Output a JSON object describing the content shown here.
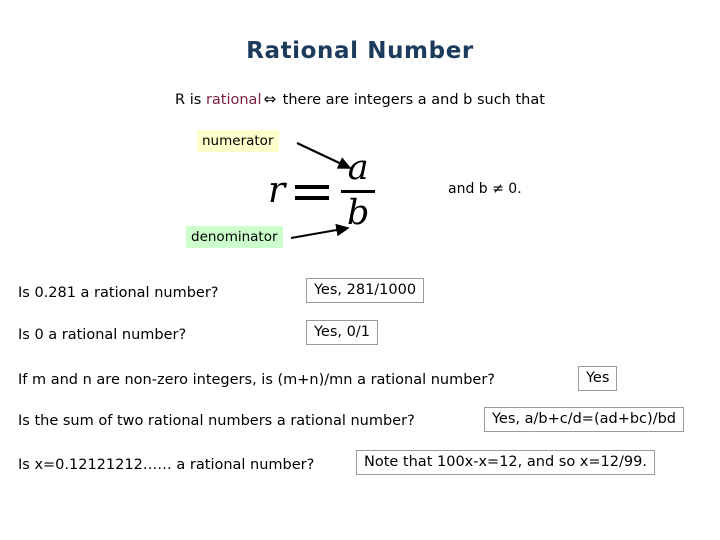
{
  "slide": {
    "title": "Rational Number",
    "definition": {
      "prefix": "R is ",
      "keyword": "rational",
      "iff_symbol": "⇔",
      "suffix": " there are integers a and b such that",
      "keyword_color": "#7d2042",
      "title_color": "#1b3a5c"
    },
    "diagram": {
      "numerator_label": "numerator",
      "numerator_highlight": "#ffffcc",
      "denominator_label": "denominator",
      "denominator_highlight": "#ccffcc",
      "equation": {
        "variable": "r",
        "relation": "=",
        "numerator": "a",
        "denominator": "b"
      },
      "condition": "and b ≠ 0."
    },
    "qa": [
      {
        "question": "Is 0.281 a rational number?",
        "answer": "Yes, 281/1000"
      },
      {
        "question": "Is 0 a rational number?",
        "answer": "Yes, 0/1"
      },
      {
        "question": "If m and n are non-zero integers, is (m+n)/mn a rational number?",
        "answer": "Yes"
      },
      {
        "question": "Is the sum of two rational numbers a rational number?",
        "answer": "Yes, a/b+c/d=(ad+bc)/bd"
      },
      {
        "question": "Is x=0.12121212…… a rational number?",
        "answer": "Note that 100x-x=12, and so x=12/99."
      }
    ]
  }
}
